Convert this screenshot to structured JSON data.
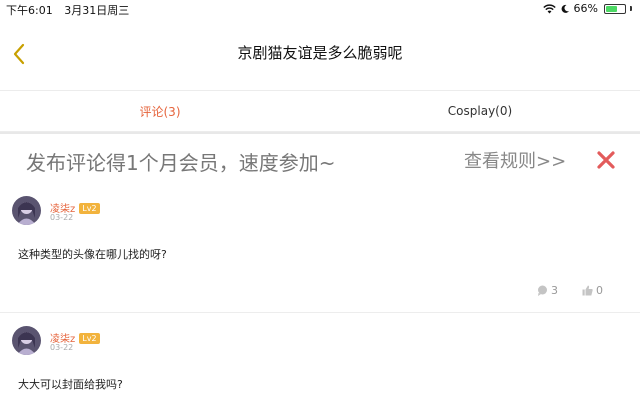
{
  "status_bar": {
    "time": "下午6:01",
    "date": "3月31日周三",
    "battery": "66%",
    "battery_level": 0.66
  },
  "header": {
    "title": "京剧猫友谊是多么脆弱呢"
  },
  "tabs": [
    {
      "label": "评论(3)",
      "active": true
    },
    {
      "label": "Cosplay(0)",
      "active": false
    }
  ],
  "banner": {
    "text": "发布评论得1个月会员，速度参加~",
    "rules_link": "查看规则>>"
  },
  "comments": [
    {
      "username": "凌柒z",
      "level": "Lv2",
      "date": "03-22",
      "text": "这种类型的头像在哪儿找的呀?",
      "replies": "3",
      "likes": "0"
    },
    {
      "username": "凌柒z",
      "level": "Lv2",
      "date": "03-22",
      "text": "大大可以封面给我吗?"
    }
  ],
  "colors": {
    "accent": "#e6643c",
    "back_arrow": "#c8a000",
    "close_x": "#e35b5b",
    "badge": "#f2b33d"
  }
}
